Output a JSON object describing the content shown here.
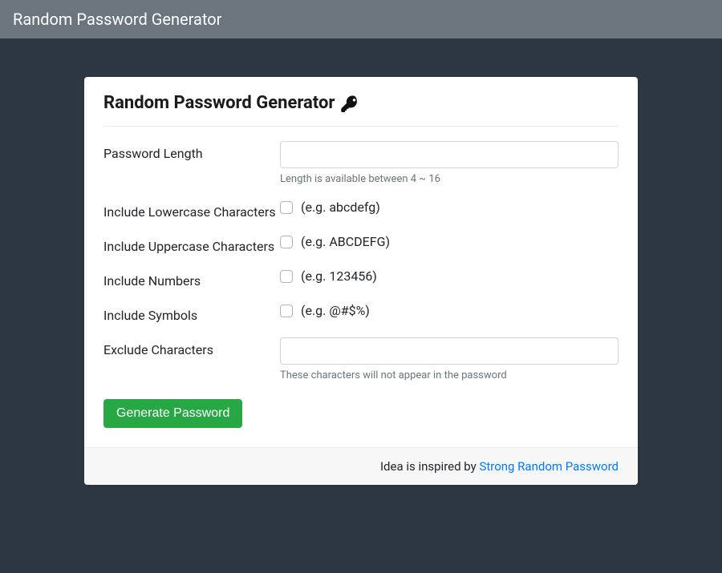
{
  "navbar": {
    "brand": "Random Password Generator"
  },
  "card": {
    "title": "Random Password Generator",
    "footer_text": "Idea is inspired by ",
    "footer_link": "Strong Random Password"
  },
  "form": {
    "length": {
      "label": "Password Length",
      "value": "",
      "help": "Length is available between 4 ~ 16"
    },
    "lowercase": {
      "label": "Include Lowercase Characters",
      "example": "(e.g. abcdefg)",
      "checked": false
    },
    "uppercase": {
      "label": "Include Uppercase Characters",
      "example": "(e.g. ABCDEFG)",
      "checked": false
    },
    "numbers": {
      "label": "Include Numbers",
      "example": "(e.g. 123456)",
      "checked": false
    },
    "symbols": {
      "label": "Include Symbols",
      "example": "(e.g. @#$%)",
      "checked": false
    },
    "exclude": {
      "label": "Exclude Characters",
      "value": "",
      "help": "These characters will not appear in the password"
    },
    "submit": "Generate Password"
  }
}
